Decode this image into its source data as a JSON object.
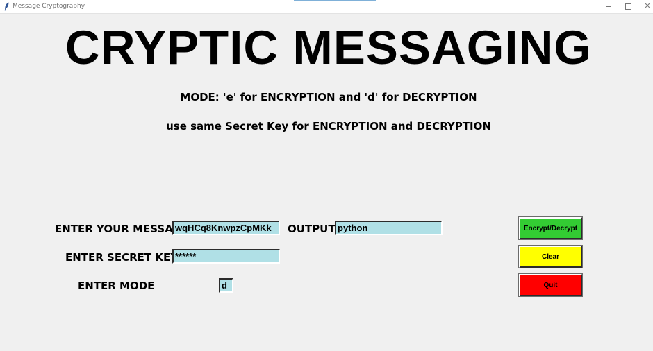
{
  "window": {
    "title": "Message Cryptography",
    "icon": "feather-icon",
    "controls": [
      "minimize-icon",
      "maximize-icon",
      "close-icon"
    ],
    "close_glyph": "✕"
  },
  "header": {
    "title": "CRYPTIC MESSAGING",
    "mode_info": "MODE: 'e' for ENCRYPTION and 'd' for DECRYPTION",
    "key_info": "use same Secret Key for ENCRYPTION and DECRYPTION"
  },
  "form": {
    "message_label": "ENTER YOUR MESSAGE",
    "message_value": "wqHCq8KnwpzCpMKk",
    "key_label": "ENTER SECRET KEY",
    "key_value": "******",
    "mode_label": "ENTER MODE",
    "mode_value": "d",
    "output_label": "OUTPUT",
    "output_value": "python"
  },
  "buttons": {
    "encrypt_label": "Encrypt/Decrypt",
    "encrypt_color": "#33cc33",
    "clear_label": "Clear",
    "clear_color": "#ffff00",
    "quit_label": "Quit",
    "quit_color": "#ff0000"
  },
  "colors": {
    "field_bg": "#b0e0e6",
    "window_bg": "#f0f0f0"
  }
}
